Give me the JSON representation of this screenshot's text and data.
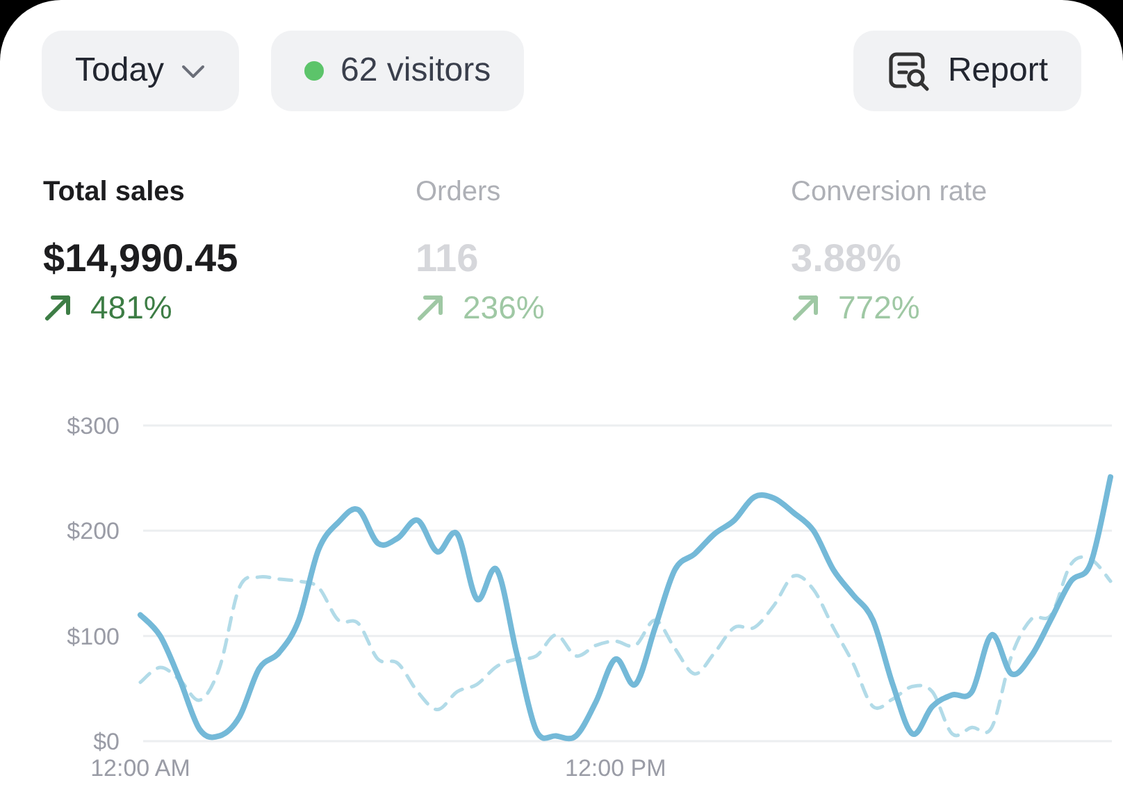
{
  "toolbar": {
    "period": {
      "label": "Today"
    },
    "visitors": {
      "label": "62 visitors",
      "color": "#5cc46a"
    },
    "report": {
      "label": "Report"
    }
  },
  "metrics": [
    {
      "label": "Total sales",
      "value": "$14,990.45",
      "change": "481%",
      "selected": true
    },
    {
      "label": "Orders",
      "value": "116",
      "change": "236%",
      "selected": false
    },
    {
      "label": "Conversion rate",
      "value": "3.88%",
      "change": "772%",
      "selected": false
    }
  ],
  "chart": {
    "chart_data": {
      "type": "line",
      "x": [
        0,
        0.5,
        1,
        1.5,
        2,
        2.5,
        3,
        3.5,
        4,
        4.5,
        5,
        5.5,
        6,
        6.5,
        7,
        7.5,
        8,
        8.5,
        9,
        9.5,
        10,
        10.5,
        11,
        11.5,
        12,
        12.5,
        13,
        13.5,
        14,
        14.5,
        15,
        15.5,
        16,
        16.5,
        17,
        17.5,
        18,
        18.5,
        19,
        19.5,
        20,
        20.5,
        21,
        21.5,
        22,
        22.5,
        23,
        23.5,
        24,
        24.5
      ],
      "series": [
        {
          "color": "#74b9d8",
          "line_style": "solid",
          "values": [
            120,
            100,
            58,
            11,
            5,
            23,
            69,
            84,
            115,
            182,
            208,
            220,
            188,
            193,
            210,
            180,
            197,
            135,
            163,
            84,
            10,
            5,
            5,
            37,
            78,
            54,
            108,
            163,
            178,
            197,
            210,
            232,
            231,
            217,
            200,
            163,
            139,
            115,
            54,
            7,
            33,
            44,
            47,
            101,
            64,
            81,
            116,
            152,
            169,
            251
          ]
        },
        {
          "color": "#b2dbe8",
          "line_style": "dashed",
          "values": [
            56,
            70,
            58,
            39,
            70,
            146,
            156,
            154,
            152,
            146,
            115,
            112,
            78,
            74,
            47,
            30,
            47,
            54,
            71,
            78,
            81,
            101,
            81,
            91,
            95,
            91,
            115,
            88,
            64,
            84,
            108,
            108,
            129,
            157,
            144,
            108,
            74,
            33,
            40,
            52,
            47,
            7,
            13,
            13,
            81,
            116,
            120,
            168,
            173,
            152
          ]
        }
      ],
      "xlim": [
        0,
        24.5
      ],
      "ylim": [
        0,
        300
      ],
      "xticks": [
        {
          "value": 0,
          "label": "12:00 AM"
        },
        {
          "value": 12,
          "label": "12:00 PM"
        }
      ],
      "yticks": [
        {
          "value": 0,
          "label": "$0"
        },
        {
          "value": 100,
          "label": "$100"
        },
        {
          "value": 200,
          "label": "$200"
        },
        {
          "value": 300,
          "label": "$300"
        }
      ]
    }
  }
}
